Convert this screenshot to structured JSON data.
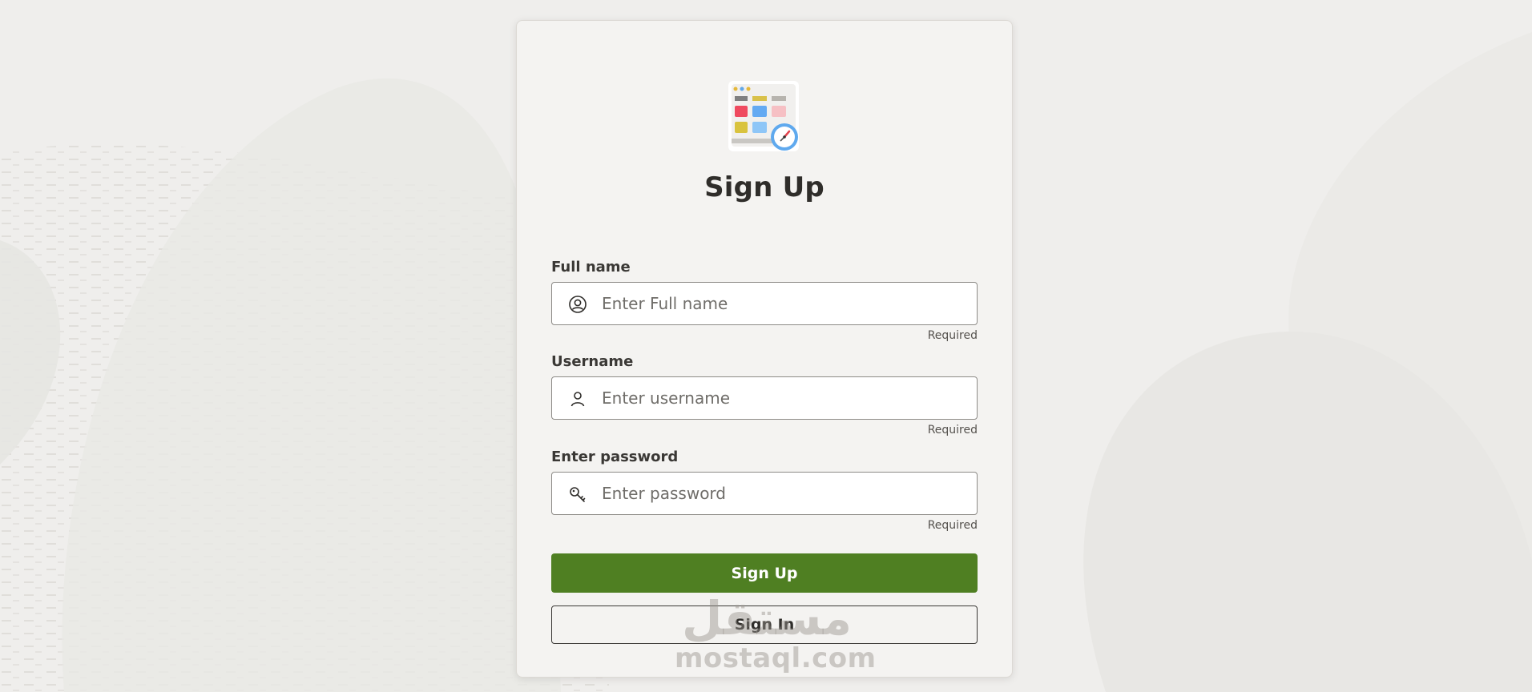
{
  "page": {
    "title": "Sign Up"
  },
  "form": {
    "fields": [
      {
        "label": "Full name",
        "placeholder": "Enter Full name",
        "value": "",
        "hint": "Required",
        "icon": "user-circle-icon"
      },
      {
        "label": "Username",
        "placeholder": "Enter username",
        "value": "",
        "hint": "Required",
        "icon": "user-icon"
      },
      {
        "label": "Enter password",
        "placeholder": "Enter password",
        "value": "",
        "hint": "Required",
        "icon": "key-icon"
      }
    ],
    "primary_button": "Sign Up",
    "secondary_button": "Sign In"
  },
  "watermark": {
    "arabic": "مستقل",
    "latin": "mostaql.com"
  },
  "colors": {
    "accent": "#4f7f22",
    "background": "#efeeec",
    "card": "#f4f3f1"
  }
}
